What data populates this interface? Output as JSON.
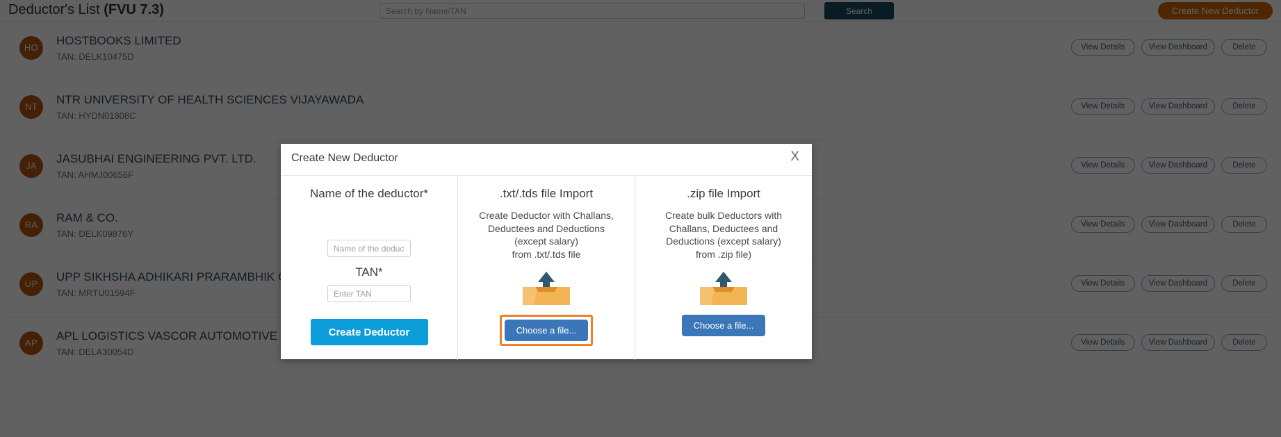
{
  "header": {
    "title_main": "Deductor's List ",
    "title_bold": "(FVU 7.3)",
    "search_placeholder": "Search by Name/TAN",
    "search_value": "",
    "search_button": "Search",
    "create_button": "Create New Deductor"
  },
  "colors": {
    "accent_orange": "#cc6600",
    "search_teal": "#1c4b5e",
    "avatar_brown": "#b35414",
    "primary_cyan": "#0d9ddb",
    "choose_blue": "#3b76b8",
    "focus_ring": "#f0802a",
    "row_name": "#2e4a63"
  },
  "row_actions": {
    "view_details": "View Details",
    "view_dashboard": "View Dashboard",
    "delete": "Delete"
  },
  "deductors": [
    {
      "initials": "HO",
      "name": "HOSTBOOKS LIMITED",
      "tan": "TAN: DELK10475D"
    },
    {
      "initials": "NT",
      "name": "NTR UNIVERSITY OF HEALTH SCIENCES VIJAYAWADA",
      "tan": "TAN: HYDN01808C"
    },
    {
      "initials": "JA",
      "name": "JASUBHAI ENGINEERING PVT. LTD.",
      "tan": "TAN: AHMJ00656F"
    },
    {
      "initials": "RA",
      "name": "RAM & CO.",
      "tan": "TAN: DELK09876Y"
    },
    {
      "initials": "UP",
      "name": "UPP SIKHSHA ADHIKARI PRARAMBHIK GAIRSAIN",
      "tan": "TAN: MRTU01594F"
    },
    {
      "initials": "AP",
      "name": "APL LOGISTICS VASCOR AUTOMOTIVE PRIVATE LIMITED",
      "tan": "TAN: DELA30054D"
    }
  ],
  "modal": {
    "title": "Create New Deductor",
    "close_label": "X",
    "form": {
      "name_label": "Name of the deductor*",
      "name_placeholder": "Name of the deductor",
      "name_value": "",
      "tan_label": "TAN*",
      "tan_placeholder": "Enter TAN",
      "tan_value": "",
      "submit_label": "Create Deductor"
    },
    "txt_import": {
      "heading": ".txt/.tds file Import",
      "description": "Create Deductor with Challans,\nDeductees and Deductions\n(except salary)\nfrom .txt/.tds file",
      "choose_label": "Choose a file..."
    },
    "zip_import": {
      "heading": ".zip file Import",
      "description": "Create bulk Deductors with\nChallans, Deductees and\nDeductions (except salary)\nfrom .zip file)",
      "choose_label": "Choose a file..."
    }
  }
}
